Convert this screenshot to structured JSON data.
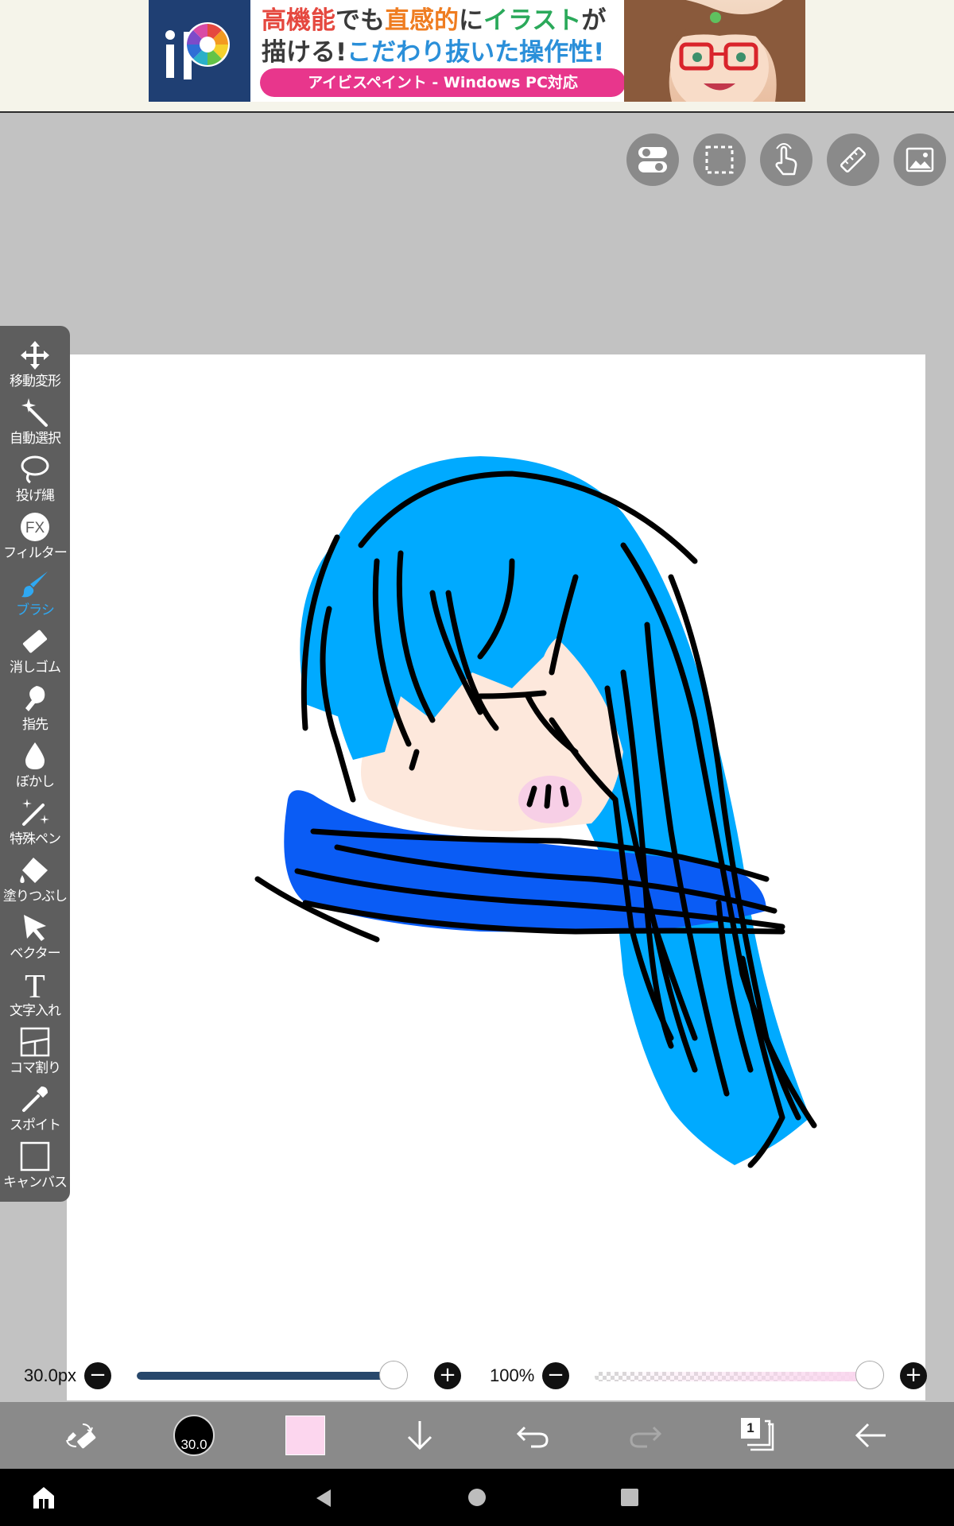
{
  "ad": {
    "line1_a": "高機能",
    "line1_b": "でも",
    "line1_c": "直感的",
    "line1_d": "に",
    "line1_e": "イラスト",
    "line1_f": "が",
    "line2_a": "描ける!",
    "line2_b": "こだわり抜いた",
    "line2_c": "操作性!",
    "cta": "アイビスペイント - Windows PC対応",
    "logo_letter": "iP"
  },
  "toolbar": {
    "items": [
      {
        "label": "移動変形",
        "icon": "move-icon"
      },
      {
        "label": "自動選択",
        "icon": "magic-wand-icon"
      },
      {
        "label": "投げ縄",
        "icon": "lasso-icon"
      },
      {
        "label": "フィルター",
        "icon": "fx-icon",
        "glyph": "FX"
      },
      {
        "label": "ブラシ",
        "icon": "brush-icon",
        "active": true
      },
      {
        "label": "消しゴム",
        "icon": "eraser-icon"
      },
      {
        "label": "指先",
        "icon": "smudge-icon"
      },
      {
        "label": "ぼかし",
        "icon": "blur-drop-icon"
      },
      {
        "label": "特殊ペン",
        "icon": "special-pen-icon"
      },
      {
        "label": "塗りつぶし",
        "icon": "fill-bucket-icon"
      },
      {
        "label": "ベクター",
        "icon": "vector-cursor-icon"
      },
      {
        "label": "文字入れ",
        "icon": "text-icon",
        "glyph": "T"
      },
      {
        "label": "コマ割り",
        "icon": "frame-divider-icon"
      },
      {
        "label": "スポイト",
        "icon": "eyedropper-icon"
      },
      {
        "label": "キャンバス",
        "icon": "canvas-icon"
      }
    ]
  },
  "top_buttons": [
    "toggle-settings-icon",
    "selection-icon",
    "touch-icon",
    "ruler-icon",
    "material-image-icon"
  ],
  "brush_size": {
    "label": "30.0px",
    "value": 30.0,
    "fraction": 0.96,
    "minus": "−",
    "plus": "+"
  },
  "opacity": {
    "label": "100%",
    "value": 100,
    "fraction": 1.0,
    "minus": "−",
    "plus": "+"
  },
  "bottom_bar": {
    "brush_size_text": "30.0",
    "color": "#fcd6ee",
    "layer_count": "1"
  },
  "colors": {
    "hair": "#00aaff",
    "scarf": "#0a5cf5",
    "skin": "#fde8dc",
    "blush": "#f7cfe6",
    "active_tool": "#2fa8f2"
  }
}
